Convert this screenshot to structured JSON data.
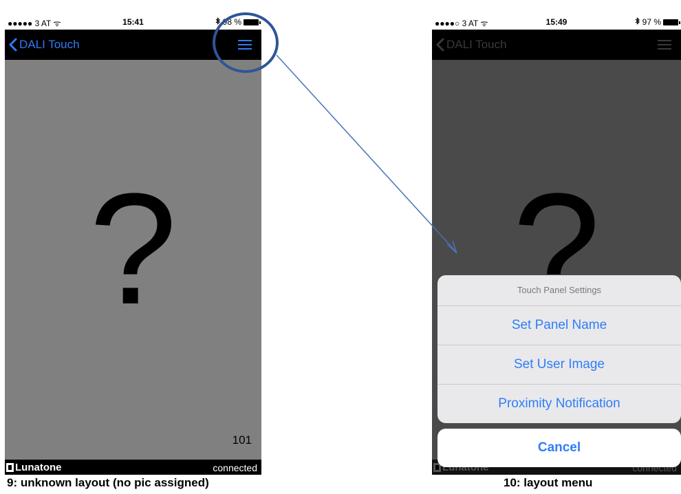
{
  "left_screen": {
    "status": {
      "carrier": "●●●●● 3 AT ᯤ",
      "time": "15:41",
      "battery": "98 %"
    },
    "nav": {
      "back_label": "DALI Touch"
    },
    "content": {
      "placeholder_glyph": "?",
      "panel_number": "101"
    },
    "footer": {
      "brand": "Lunatone",
      "connection": "connected"
    },
    "caption": "9: unknown layout (no pic assigned)"
  },
  "right_screen": {
    "status": {
      "carrier": "●●●●○ 3 AT ᯤ",
      "time": "15:49",
      "battery": "97 %"
    },
    "nav": {
      "back_label": "DALI Touch"
    },
    "content": {
      "placeholder_glyph": "?"
    },
    "action_sheet": {
      "title": "Touch Panel Settings",
      "items": [
        {
          "label": "Set Panel Name"
        },
        {
          "label": "Set User Image"
        },
        {
          "label": "Proximity Notification"
        }
      ],
      "cancel_label": "Cancel"
    },
    "footer": {
      "brand": "Lunatone",
      "connection": "connected"
    },
    "caption": "10: layout menu"
  },
  "colors": {
    "ios_blue": "#2f7df6",
    "annotation_blue": "#2f5597",
    "content_gray": "#808080",
    "dimmed_gray": "#4a4a4a"
  },
  "icons": {
    "back": "chevron-left-icon",
    "menu": "hamburger-menu-icon",
    "bluetooth": "bluetooth-icon",
    "battery": "battery-icon",
    "brand_logo": "lunatone-logo"
  }
}
